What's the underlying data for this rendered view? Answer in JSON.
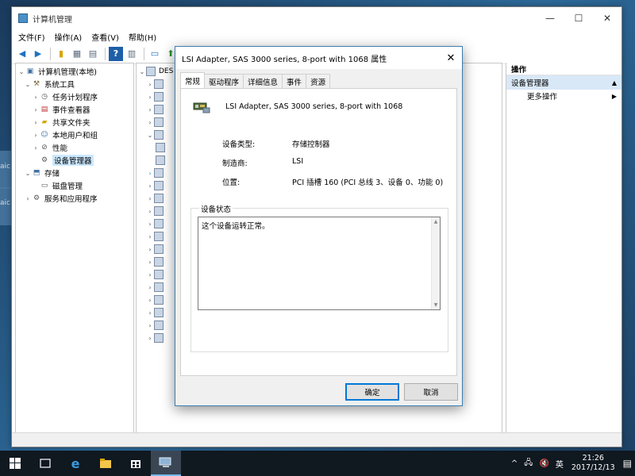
{
  "window": {
    "title": "计算机管理",
    "minimize": "—",
    "maximize": "☐",
    "close": "✕"
  },
  "menu": [
    "文件(F)",
    "操作(A)",
    "查看(V)",
    "帮助(H)"
  ],
  "tree": {
    "root": "计算机管理(本地)",
    "system_tools": "系统工具",
    "task_scheduler": "任务计划程序",
    "event_viewer": "事件查看器",
    "shared_folders": "共享文件夹",
    "local_users": "本地用户和组",
    "performance": "性能",
    "device_manager": "设备管理器",
    "storage": "存储",
    "disk_management": "磁盘管理",
    "services_apps": "服务和应用程序"
  },
  "middle": {
    "root_label": "DES"
  },
  "actions": {
    "header": "操作",
    "section": "设备管理器",
    "more": "更多操作"
  },
  "dialog": {
    "title": "LSI Adapter, SAS 3000 series, 8-port with 1068 属性",
    "close": "✕",
    "tabs": [
      "常规",
      "驱动程序",
      "详细信息",
      "事件",
      "资源"
    ],
    "device_name": "LSI Adapter, SAS 3000 series, 8-port with 1068",
    "type_label": "设备类型:",
    "type_value": "存储控制器",
    "mfr_label": "制造商:",
    "mfr_value": "LSI",
    "loc_label": "位置:",
    "loc_value": "PCI 插槽 160 (PCI 总线 3、设备 0、功能 0)",
    "status_group": "设备状态",
    "status_text": "这个设备运转正常。",
    "ok": "确定",
    "cancel": "取消"
  },
  "desktop_icons": [
    "aic",
    "aic"
  ],
  "taskbar": {
    "ime": "英",
    "time": "21:26",
    "date": "2017/12/13"
  }
}
